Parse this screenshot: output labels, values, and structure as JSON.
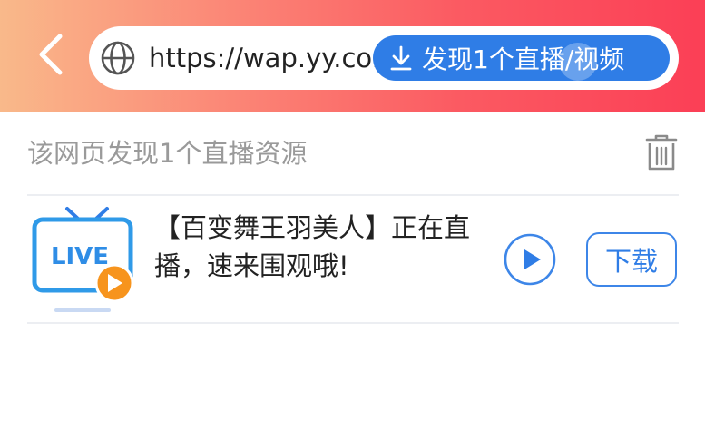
{
  "address_bar": {
    "url": "https://wap.yy.com",
    "found_label": "发现1个直播/视频"
  },
  "panel": {
    "title": "该网页发现1个直播资源"
  },
  "streams": [
    {
      "title": "【百变舞王羽美人】正在直播，速来围观哦!",
      "thumbnail_badge": "LIVE",
      "download_label": "下载"
    }
  ],
  "colors": {
    "header_gradient": [
      "#f9b98a",
      "#fb5a62",
      "#fb3f56"
    ],
    "accent_blue": "#2f7de6",
    "live_orange": "#f7941d"
  },
  "icons": {
    "back": "chevron-left-icon",
    "globe": "globe-icon",
    "download": "download-arrow-icon",
    "trash": "trash-icon",
    "play": "play-circle-icon",
    "live_tv": "live-tv-icon"
  }
}
